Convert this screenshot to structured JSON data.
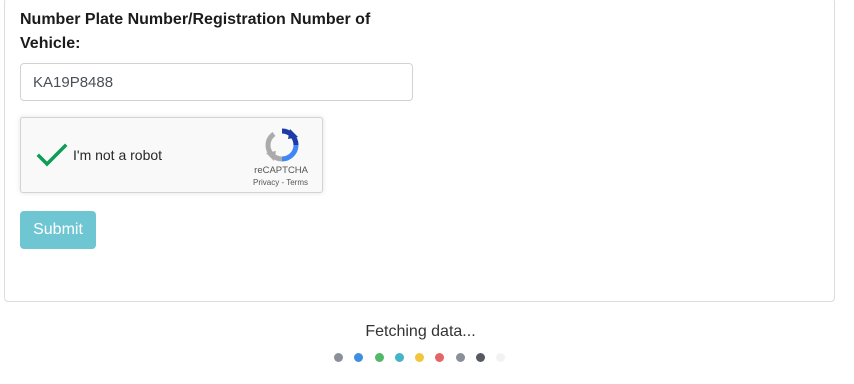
{
  "form": {
    "label": "Number Plate Number/Registration Number of Vehicle:",
    "plate_value": "KA19P8488",
    "submit_label": "Submit"
  },
  "recaptcha": {
    "checkbox_label": "I'm not a robot",
    "brand": "reCAPTCHA",
    "privacy_link": "Privacy",
    "separator": " - ",
    "terms_link": "Terms",
    "checked": true,
    "check_color": "#0f9d58"
  },
  "status": {
    "fetching_text": "Fetching data..."
  },
  "loader": {
    "dot_colors": [
      "#8a9097",
      "#3d8fe0",
      "#52b96a",
      "#45b3c8",
      "#f2c53c",
      "#e46467",
      "#8a9097",
      "#555a60",
      "#f2f2f2"
    ]
  }
}
